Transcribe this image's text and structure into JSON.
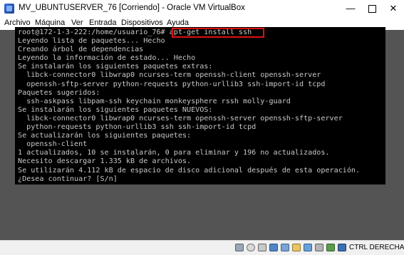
{
  "window": {
    "title": "MV_UBUNTUSERVER_76 [Corriendo] - Oracle VM VirtualBox",
    "minimize_glyph": "—",
    "close_glyph": "✕"
  },
  "menu": {
    "items": [
      "Archivo",
      "Máquina",
      "Ver",
      "Entrada",
      "Dispositivos",
      "Ayuda"
    ]
  },
  "terminal": {
    "lines": [
      "root@172-1-3-222:/home/usuario_76# apt-get install ssh",
      "Leyendo lista de paquetes... Hecho",
      "Creando árbol de dependencias",
      "Leyendo la información de estado... Hecho",
      "Se instalarán los siguientes paquetes extras:",
      "  libck-connector0 libwrap0 ncurses-term openssh-client openssh-server",
      "  openssh-sftp-server python-requests python-urllib3 ssh-import-id tcpd",
      "Paquetes sugeridos:",
      "  ssh-askpass libpam-ssh keychain monkeysphere rssh molly-guard",
      "Se instalarán los siguientes paquetes NUEVOS:",
      "  libck-connector0 libwrap0 ncurses-term openssh-server openssh-sftp-server",
      "  python-requests python-urllib3 ssh ssh-import-id tcpd",
      "Se actualizarán los siguientes paquetes:",
      "  openssh-client",
      "1 actualizados, 10 se instalarán, 0 para eliminar y 196 no actualizados.",
      "Necesito descargar 1.335 kB de archivos.",
      "Se utilizarán 4.112 kB de espacio de disco adicional después de esta operación.",
      "¿Desea continuar? [S/n]"
    ]
  },
  "status_bar": {
    "icons": [
      "hard-disk-icon",
      "optical-drive-icon",
      "audio-icon",
      "network-icon",
      "usb-icon",
      "shared-folders-icon",
      "display-icon",
      "video-capture-icon",
      "mouse-integration-icon",
      "host-key-icon"
    ],
    "host_key_label": "CTRL DERECHA"
  },
  "colors": {
    "terminal_bg": "#000000",
    "terminal_text": "#c8c8c8",
    "vm_border": "#545454",
    "highlight_box": "#e01010"
  }
}
